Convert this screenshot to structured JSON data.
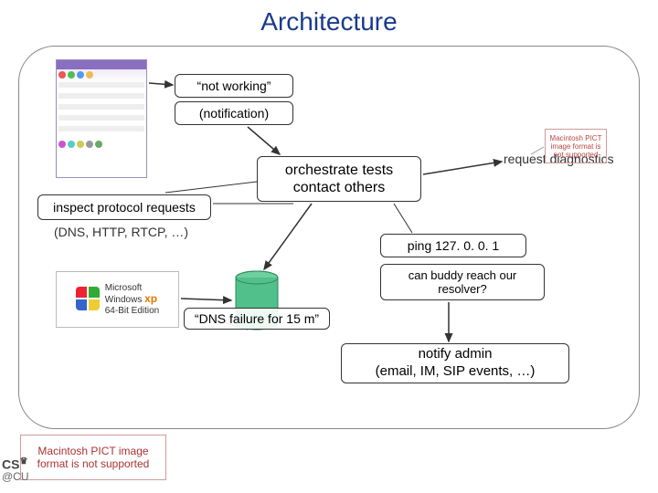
{
  "title": "Architecture",
  "labels": {
    "not_working": "“not working”",
    "notification": "(notification)",
    "inspect": "inspect protocol requests",
    "protocols": "(DNS, HTTP, RTCP, …)",
    "orchestrate_l1": "orchestrate tests",
    "orchestrate_l2": "contact others",
    "request_diag": "request diagnostics",
    "ping": "ping 127. 0. 0. 1",
    "buddy": "can buddy reach our resolver?",
    "dns_fail": "“DNS failure for 15 m”",
    "notify_l1": "notify admin",
    "notify_l2": "(email, IM, SIP events, …)"
  },
  "placeholders": {
    "mac_small": "Macintosh PICT image format is not supported",
    "mac_large": "Macintosh PICT image format is not supported"
  },
  "winlogo": {
    "brand": "Microsoft",
    "product": "Windows",
    "edition_suffix": "xp",
    "subtitle": "64-Bit Edition"
  },
  "footer": {
    "cs": "CS",
    "cu": "@CU"
  }
}
